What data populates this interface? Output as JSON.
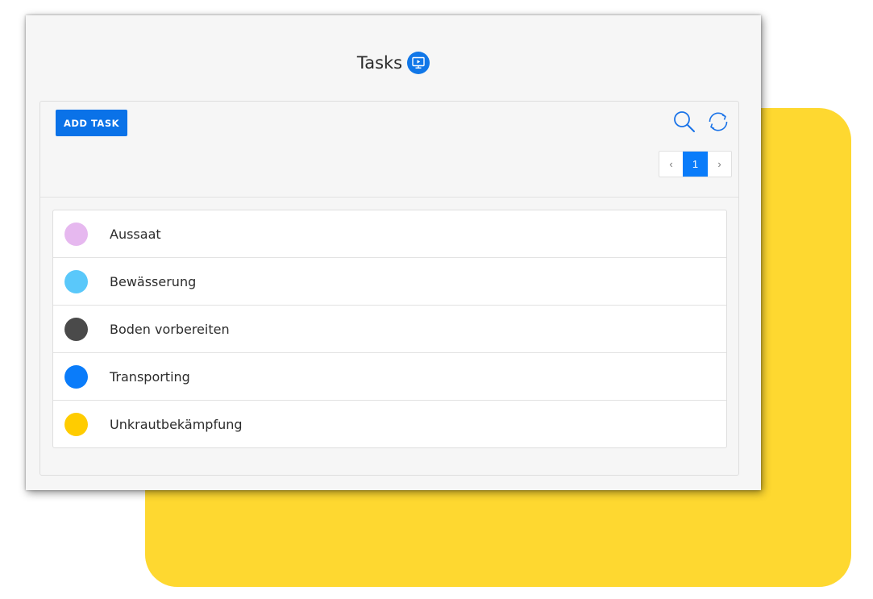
{
  "header": {
    "title": "Tasks",
    "title_icon": "monitor-play-icon"
  },
  "toolbar": {
    "add_label": "ADD TASK",
    "search_icon": "search-icon",
    "refresh_icon": "refresh-icon"
  },
  "pagination": {
    "prev": "‹",
    "current": "1",
    "next": "›"
  },
  "tasks": [
    {
      "label": "Aussaat",
      "color": "#e6b8ef"
    },
    {
      "label": "Bewässerung",
      "color": "#5ac8fa"
    },
    {
      "label": "Boden vorbereiten",
      "color": "#4a4a4a"
    },
    {
      "label": "Transporting",
      "color": "#0a7cfa"
    },
    {
      "label": "Unkrautbekämpfung",
      "color": "#ffcc00"
    }
  ],
  "colors": {
    "accent": "#0a72e8",
    "background_shape": "#fed830"
  }
}
